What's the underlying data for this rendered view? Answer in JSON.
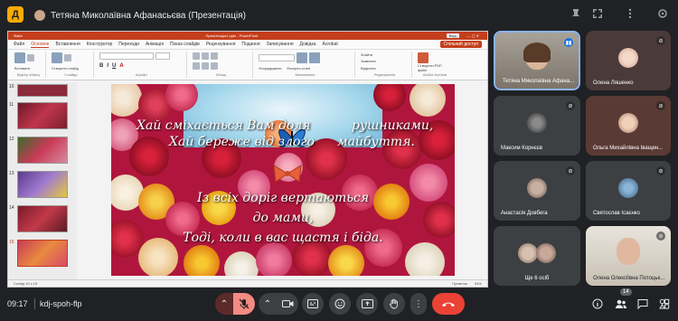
{
  "topbar": {
    "logo_letter": "Д",
    "presenter_label": "Тетяна Миколаївна Афанасьєва (Презентація)"
  },
  "powerpoint": {
    "title": "Презентація1.pptx - PowerPoint",
    "title_left": "Файл",
    "title_right_btn": "Вхід",
    "menu": [
      "Файл",
      "Основне",
      "Вставлення",
      "Конструктор",
      "Переходи",
      "Анімація",
      "Показ слайдів",
      "Рецензування",
      "Подання",
      "Записування",
      "Довідка",
      "Acrobat"
    ],
    "active_menu": "Основне",
    "share_label": "Спільний доступ",
    "ribbon_groups": [
      "Буфер обміну",
      "Слайди",
      "Шрифт",
      "Абзац",
      "Малювання",
      "Редагування",
      "Adobe Acrobat"
    ],
    "ribbon_items": {
      "paste": "Вставити",
      "new_slide": "Створити слайд",
      "reset": "Макет",
      "arrange": "Упорядкувати",
      "quick_styles": "Експрес-стилі",
      "find": "Знайти",
      "replace": "Замінити",
      "select": "Виділити",
      "create_pdf": "Створити PDF-файл"
    },
    "thumb_numbers": [
      "10",
      "11",
      "12",
      "13",
      "14",
      "15"
    ],
    "selected_thumb": "15",
    "slide_lines": [
      "Хай сміхається Вам доля",
      "Хай береже від злого",
      "рушниками,",
      "майбуття.",
      "Із всіх доріг вертаються",
      "до мами,",
      "Тоді, коли в вас щастя і біда."
    ],
    "status_left": "Слайд 15 з 15",
    "status_notes": "Примітки",
    "status_zoom": "54%"
  },
  "participants": [
    {
      "name": "Тетяна Миколаївна Афана...",
      "mic": "active"
    },
    {
      "name": "Олена Ляшенко",
      "mic": "muted"
    },
    {
      "name": "Максим Корнєєв",
      "mic": "muted"
    },
    {
      "name": "Ольга Михайлівна Іващен...",
      "mic": "muted"
    },
    {
      "name": "Анастасія Довбега",
      "mic": "muted"
    },
    {
      "name": "Святослав Ісаєнко",
      "mic": "muted"
    },
    {
      "name": "Ще 6 осіб",
      "mic": ""
    },
    {
      "name": "Олена Олексіївна Потоцьк...",
      "mic": "muted"
    }
  ],
  "bottombar": {
    "time": "09:17",
    "meeting_code": "kdj-spoh-flp",
    "participant_count": "14"
  },
  "colors": {
    "ppt_accent": "#c43e1c",
    "meet_bg": "#202124",
    "tile_bg": "#3c4043",
    "mute_red": "#f28b82",
    "leave_red": "#ea4335",
    "active_blue": "#1a73e8"
  }
}
